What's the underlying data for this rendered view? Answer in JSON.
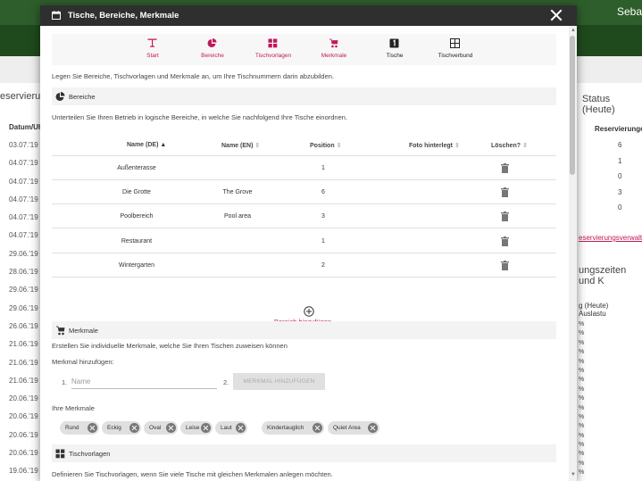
{
  "background": {
    "user_name": "Seba",
    "left_title": "eservierun",
    "left_header": "Datum/Uh",
    "left_dates": [
      "03.07.'19",
      "04.07.'19",
      "04.07.'19",
      "04.07.'19",
      "04.07.'19",
      "04.07.'19",
      "29.06.'19",
      "28.06.'19",
      "29.06.'19",
      "29.06.'19",
      "26.06.'19",
      "21.06.'19",
      "21.06.'19",
      "21.06.'19",
      "20.06.'19",
      "20.06.'19",
      "20.06.'19",
      "20.06.'19",
      "19.06.'19"
    ],
    "right_title": "Status (Heute)",
    "right_header": "Reservierunge",
    "right_values": [
      "6",
      "1",
      "0",
      "3",
      "0"
    ],
    "right_link": "eservierungsverwaltu",
    "right_title2": "ungszeiten und K",
    "right_sub_a": "g (Heute)",
    "right_sub_b": "Auslastu",
    "right_pcts": [
      "%",
      "%",
      "%",
      "%",
      "%",
      "%",
      "%",
      "%",
      "%",
      "%",
      "%",
      "%",
      "%",
      "%",
      "%",
      "%",
      "%"
    ]
  },
  "dialog": {
    "title": "Tische, Bereiche, Merkmale",
    "toolbar": [
      {
        "label": "Start",
        "icon": "table-icon",
        "color": "#c2185b"
      },
      {
        "label": "Bereiche",
        "icon": "pie-chart-icon",
        "color": "#c2185b"
      },
      {
        "label": "Tischvorlagen",
        "icon": "grid-icon",
        "color": "#c2185b"
      },
      {
        "label": "Merkmale",
        "icon": "stroller-icon",
        "color": "#c2185b"
      },
      {
        "label": "Tische",
        "icon": "number-1-icon",
        "color": "#222222"
      },
      {
        "label": "Tischverbund",
        "icon": "table-group-icon",
        "color": "#222222"
      }
    ],
    "intro": "Legen Sie Bereiche, Tischvorlagen und Merkmale an, um Ihre Tischnummern darin abzubilden.",
    "bereiche": {
      "header": "Bereiche",
      "description": "Unterteilen Sie Ihren Betrieb in logische Bereiche, in welche Sie nachfolgend Ihre Tische einordnen.",
      "columns": {
        "name_de": "Name (DE)",
        "name_en": "Name (EN)",
        "position": "Position",
        "foto": "Foto hinterlegt",
        "delete": "Löschen?"
      },
      "rows": [
        {
          "name_de": "Außenterasse",
          "name_en": "",
          "position": "1"
        },
        {
          "name_de": "Die Grotte",
          "name_en": "The Grove",
          "position": "6"
        },
        {
          "name_de": "Poolbereich",
          "name_en": "Pool area",
          "position": "3"
        },
        {
          "name_de": "Restaurant",
          "name_en": "",
          "position": "1"
        },
        {
          "name_de": "Wintergarten",
          "name_en": "",
          "position": "2"
        }
      ],
      "add_link": "Bereich hinzufügen"
    },
    "merkmale": {
      "header": "Merkmale",
      "description": "Erstellen Sie individuelle Merkmale, welche Sie Ihren Tischen zuweisen können",
      "add_label": "Merkmal hinzufügen:",
      "step1": "1.",
      "step2": "2.",
      "name_value": "",
      "name_placeholder": "Name",
      "add_button": "MERKMAL HINZUFÜGEN",
      "list_title": "Ihre Merkmale",
      "chips": [
        "Rund",
        "Eckig",
        "Oval",
        "Leise",
        "Laut",
        "Kindertauglich",
        "Quiet Area"
      ]
    },
    "tischvorlagen": {
      "header": "Tischvorlagen",
      "description": "Definieren Sie Tischvorlagen, wenn Sie viele Tische mit gleichen Merkmalen anlegen möchten."
    }
  },
  "colors": {
    "accent": "#c2185b",
    "header_bg": "#2f2f2f",
    "app_green": "#2e5e2b"
  }
}
